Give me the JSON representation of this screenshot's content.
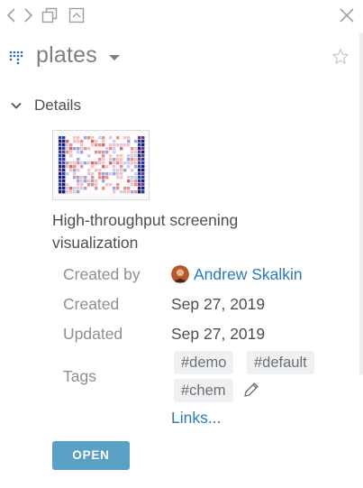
{
  "toolbar": {
    "icons": [
      "chevron-left-icon",
      "chevron-right-icon",
      "copy-icon",
      "collapse-up-icon",
      "close-icon"
    ]
  },
  "header": {
    "title": "plates"
  },
  "details": {
    "section_label": "Details",
    "description": "High-throughput screening visualization",
    "fields": {
      "created_by_label": "Created by",
      "created_by_value": "Andrew Skalkin",
      "created_label": "Created",
      "created_value": "Sep 27, 2019",
      "updated_label": "Updated",
      "updated_value": "Sep 27, 2019",
      "tags_label": "Tags"
    },
    "tags": [
      "#demo",
      "#default",
      "#chem"
    ],
    "links_label": "Links...",
    "open_label": "OPEN"
  },
  "colors": {
    "link": "#2a7ab8",
    "open_button": "#5a9fc4",
    "tag_bg": "#eef0f2"
  }
}
